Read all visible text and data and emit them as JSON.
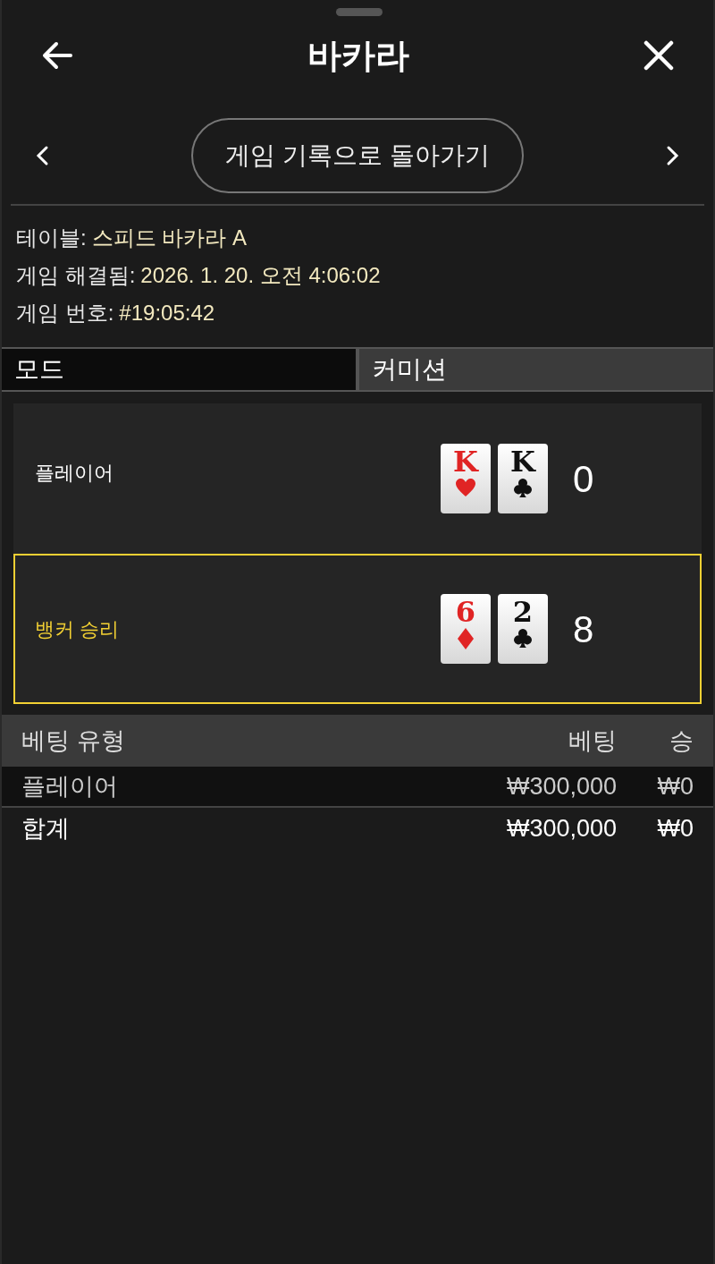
{
  "window": {
    "title": "바카라"
  },
  "nav": {
    "back_to_history_button": "게임 기록으로 돌아가기"
  },
  "info": [
    {
      "label": "테이블:",
      "value": "스피드 바카라 A"
    },
    {
      "label": "게임 해결됨:",
      "value": "2026. 1. 20. 오전 4:06:02"
    },
    {
      "label": "게임 번호:",
      "value": "#19:05:42"
    }
  ],
  "tabs": [
    {
      "label": "모드",
      "selected": true
    },
    {
      "label": "커미션",
      "selected": false
    }
  ],
  "hands": [
    {
      "label": "플레이어",
      "winner": false,
      "cards": [
        {
          "rank": "K",
          "kind": "hearts"
        },
        {
          "rank": "K",
          "kind": "clubs"
        }
      ],
      "score": "0"
    },
    {
      "label": "뱅커 승리",
      "winner": true,
      "cards": [
        {
          "rank": "6",
          "kind": "diamonds"
        },
        {
          "rank": "2",
          "kind": "clubs"
        }
      ],
      "score": "8"
    }
  ],
  "bets": {
    "columns": [
      "베팅 유형",
      "베팅",
      "승"
    ],
    "rows": [
      [
        "플레이어",
        "₩300,000",
        "₩0"
      ]
    ],
    "total": [
      "합계",
      "₩300,000",
      "₩0"
    ]
  }
}
